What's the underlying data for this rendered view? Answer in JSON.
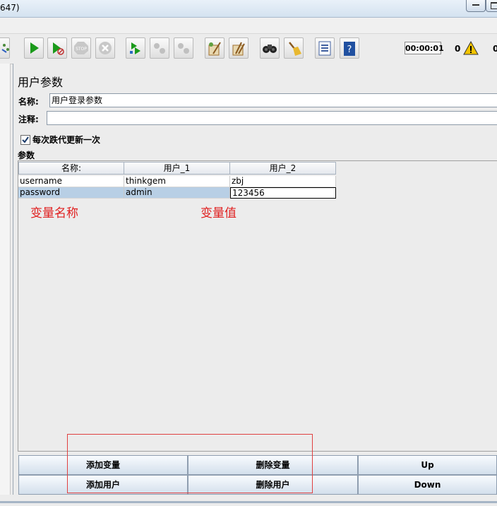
{
  "window": {
    "title_fragment": "647)"
  },
  "toolbar": {
    "buttons": [
      {
        "name": "expand-tree-icon",
        "color": "#4a8a3a"
      },
      {
        "name": "start-icon",
        "color": "#1a9a1a"
      },
      {
        "name": "start-no-pauses-icon",
        "color": "#1a9a1a"
      },
      {
        "name": "stop-icon",
        "color": "#bdbdbd"
      },
      {
        "name": "shutdown-icon",
        "color": "#bdbdbd"
      },
      {
        "name": "remote-start-icon",
        "color": "#1a9a1a"
      },
      {
        "name": "remote-stop-icon",
        "color": "#bdbdbd"
      },
      {
        "name": "remote-shutdown-icon",
        "color": "#bdbdbd"
      },
      {
        "name": "clear-icon",
        "color": "#a07030"
      },
      {
        "name": "clear-all-icon",
        "color": "#a07030"
      },
      {
        "name": "search-binoculars-icon",
        "color": "#222222"
      },
      {
        "name": "reset-search-broom-icon",
        "color": "#d0a020"
      },
      {
        "name": "function-helper-icon",
        "color": "#4060a0"
      },
      {
        "name": "help-icon",
        "color": "#2050a0"
      }
    ],
    "timer": "00:00:01",
    "warning_count": "0",
    "right_count": "0"
  },
  "panel": {
    "heading": "用户参数",
    "name_label": "名称:",
    "name_value": "用户登录参数",
    "comment_label": "注释:",
    "comment_value": "",
    "checkbox_label": "每次跌代更新一次",
    "checkbox_checked": true,
    "params_label": "参数"
  },
  "table": {
    "headers": [
      "名称:",
      "用户_1",
      "用户_2"
    ],
    "rows": [
      [
        "username",
        "thinkgem",
        "zbj"
      ],
      [
        "password",
        "admin",
        "123456"
      ]
    ]
  },
  "annotations": {
    "var_name": "变量名称",
    "var_value": "变量值"
  },
  "buttons": {
    "add_variable": "添加变量",
    "delete_variable": "删除变量",
    "up": "Up",
    "add_user": "添加用户",
    "delete_user": "删除用户",
    "down": "Down"
  },
  "colors": {
    "annotation_red": "#e02020",
    "selected_row": "#b8cfe5"
  }
}
